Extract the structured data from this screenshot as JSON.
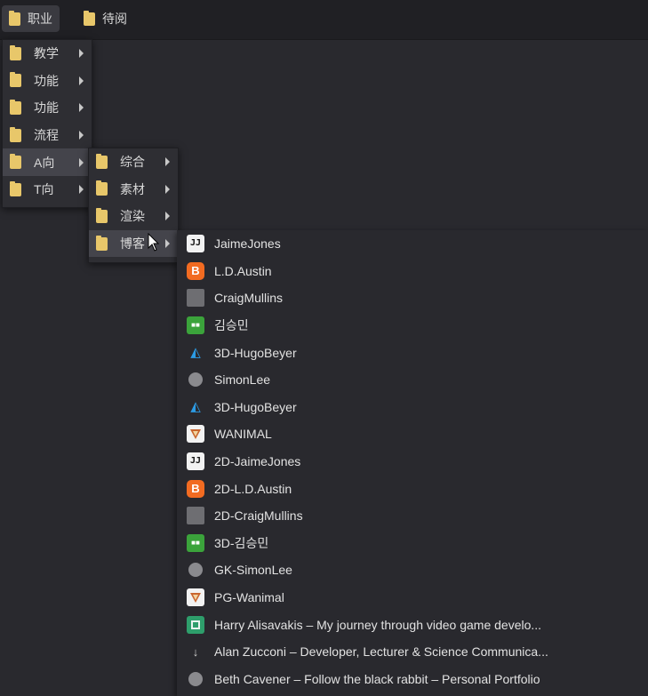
{
  "bookmark_bar": {
    "items": [
      {
        "label": "职业",
        "icon": "folder-icon"
      },
      {
        "label": "待阅",
        "icon": "folder-icon"
      }
    ]
  },
  "menu_level1": [
    {
      "label": "教学"
    },
    {
      "label": "功能"
    },
    {
      "label": "功能"
    },
    {
      "label": "流程"
    },
    {
      "label": "A向"
    },
    {
      "label": "T向"
    }
  ],
  "menu_level2": [
    {
      "label": "综合"
    },
    {
      "label": "素材"
    },
    {
      "label": "渲染"
    },
    {
      "label": "博客"
    }
  ],
  "bookmarks": [
    {
      "label": "JaimeJones",
      "icon": "jj-icon"
    },
    {
      "label": "L.D.Austin",
      "icon": "blogger-icon"
    },
    {
      "label": "CraigMullins",
      "icon": "cube-icon"
    },
    {
      "label": "김승민",
      "icon": "game-icon"
    },
    {
      "label": "3D-HugoBeyer",
      "icon": "artstation-icon"
    },
    {
      "label": "SimonLee",
      "icon": "globe-icon"
    },
    {
      "label": "3D-HugoBeyer",
      "icon": "artstation-icon"
    },
    {
      "label": "WANIMAL",
      "icon": "wanimal-icon"
    },
    {
      "label": "2D-JaimeJones",
      "icon": "jj-icon"
    },
    {
      "label": "2D-L.D.Austin",
      "icon": "blogger-icon"
    },
    {
      "label": "2D-CraigMullins",
      "icon": "cube-icon"
    },
    {
      "label": "3D-김승민",
      "icon": "game-icon"
    },
    {
      "label": "GK-SimonLee",
      "icon": "globe-icon"
    },
    {
      "label": "PG-Wanimal",
      "icon": "wanimal-icon"
    },
    {
      "label": "Harry Alisavakis – My journey through video game develo...",
      "icon": "harry-icon"
    },
    {
      "label": "Alan Zucconi – Developer, Lecturer & Science Communica...",
      "icon": "alan-icon"
    },
    {
      "label": "Beth Cavener – Follow the black rabbit – Personal Portfolio",
      "icon": "globe-icon"
    }
  ],
  "icon_glyphs": {
    "jj": "JJ",
    "blogger": "B",
    "artstation": "◭",
    "game": "■■",
    "alan": "↓"
  },
  "colors": {
    "background": "#29292e",
    "menu_bg": "#2e2e33",
    "folder": "#e8c76a",
    "highlight": "#44444b"
  }
}
